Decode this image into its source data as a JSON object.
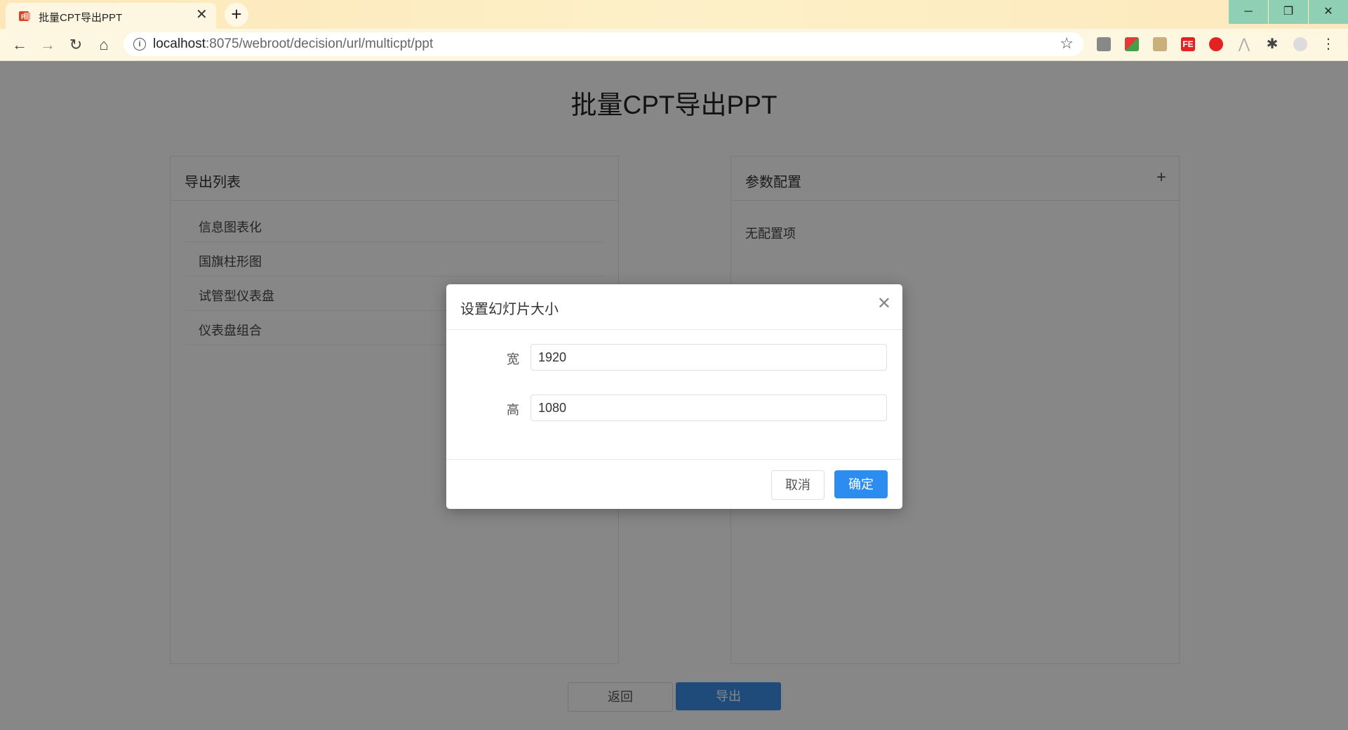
{
  "browser": {
    "tab_title": "批量CPT导出PPT",
    "url_host": "localhost",
    "url_rest": ":8075/webroot/decision/url/multicpt/ppt",
    "extensions": [
      "extension-1",
      "extension-2",
      "extension-3",
      "extension-fe",
      "extension-5",
      "extension-6",
      "puzzle-extension",
      "profile-avatar"
    ]
  },
  "page": {
    "title": "批量CPT导出PPT",
    "export_list": {
      "title": "导出列表",
      "items": [
        "信息图表化",
        "国旗柱形图",
        "试管型仪表盘",
        "仪表盘组合"
      ]
    },
    "params": {
      "title": "参数配置",
      "add_symbol": "+",
      "empty_text": "无配置项"
    },
    "back_label": "返回",
    "export_label": "导出"
  },
  "modal": {
    "title": "设置幻灯片大小",
    "width_label": "宽",
    "width_value": "1920",
    "height_label": "高",
    "height_value": "1080",
    "cancel_label": "取消",
    "ok_label": "确定"
  },
  "colors": {
    "primary": "#2d8cf0",
    "chrome": "#fdf6e0",
    "window_controls": "#8fcfb4"
  }
}
